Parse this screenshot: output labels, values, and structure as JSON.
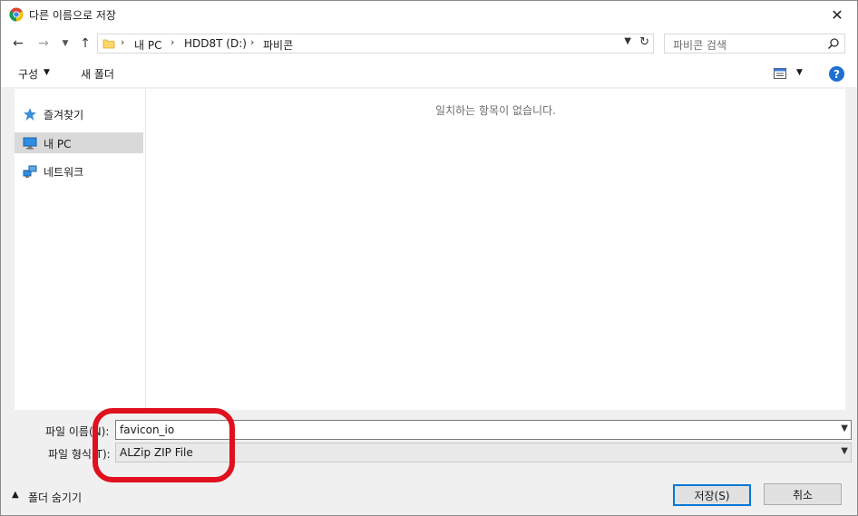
{
  "window": {
    "title": "다른 이름으로 저장"
  },
  "address": {
    "crumbs": [
      "내 PC",
      "HDD8T (D:)",
      "파비콘"
    ],
    "separator": "›"
  },
  "search": {
    "placeholder": "파비콘 검색"
  },
  "toolbar": {
    "organize": "구성",
    "new_folder": "새 폴더",
    "help": "?"
  },
  "sidebar": {
    "items": [
      {
        "label": "즐겨찾기",
        "icon": "star-icon"
      },
      {
        "label": "내 PC",
        "icon": "computer-icon",
        "selected": true
      },
      {
        "label": "네트워크",
        "icon": "network-icon"
      }
    ]
  },
  "file_list": {
    "empty_message": "일치하는 항목이 없습니다."
  },
  "fields": {
    "filename_label": "파일 이름(N):",
    "filename_value": "favicon_io",
    "filetype_label": "파일 형식(T):",
    "filetype_value": "ALZip ZIP File"
  },
  "footer": {
    "hide_folders": "폴더 숨기기",
    "save_label": "저장(S)",
    "cancel_label": "취소"
  },
  "colors": {
    "highlight": "#e0101f",
    "accent": "#0078d7",
    "selected_bg": "#d9d9d9"
  }
}
